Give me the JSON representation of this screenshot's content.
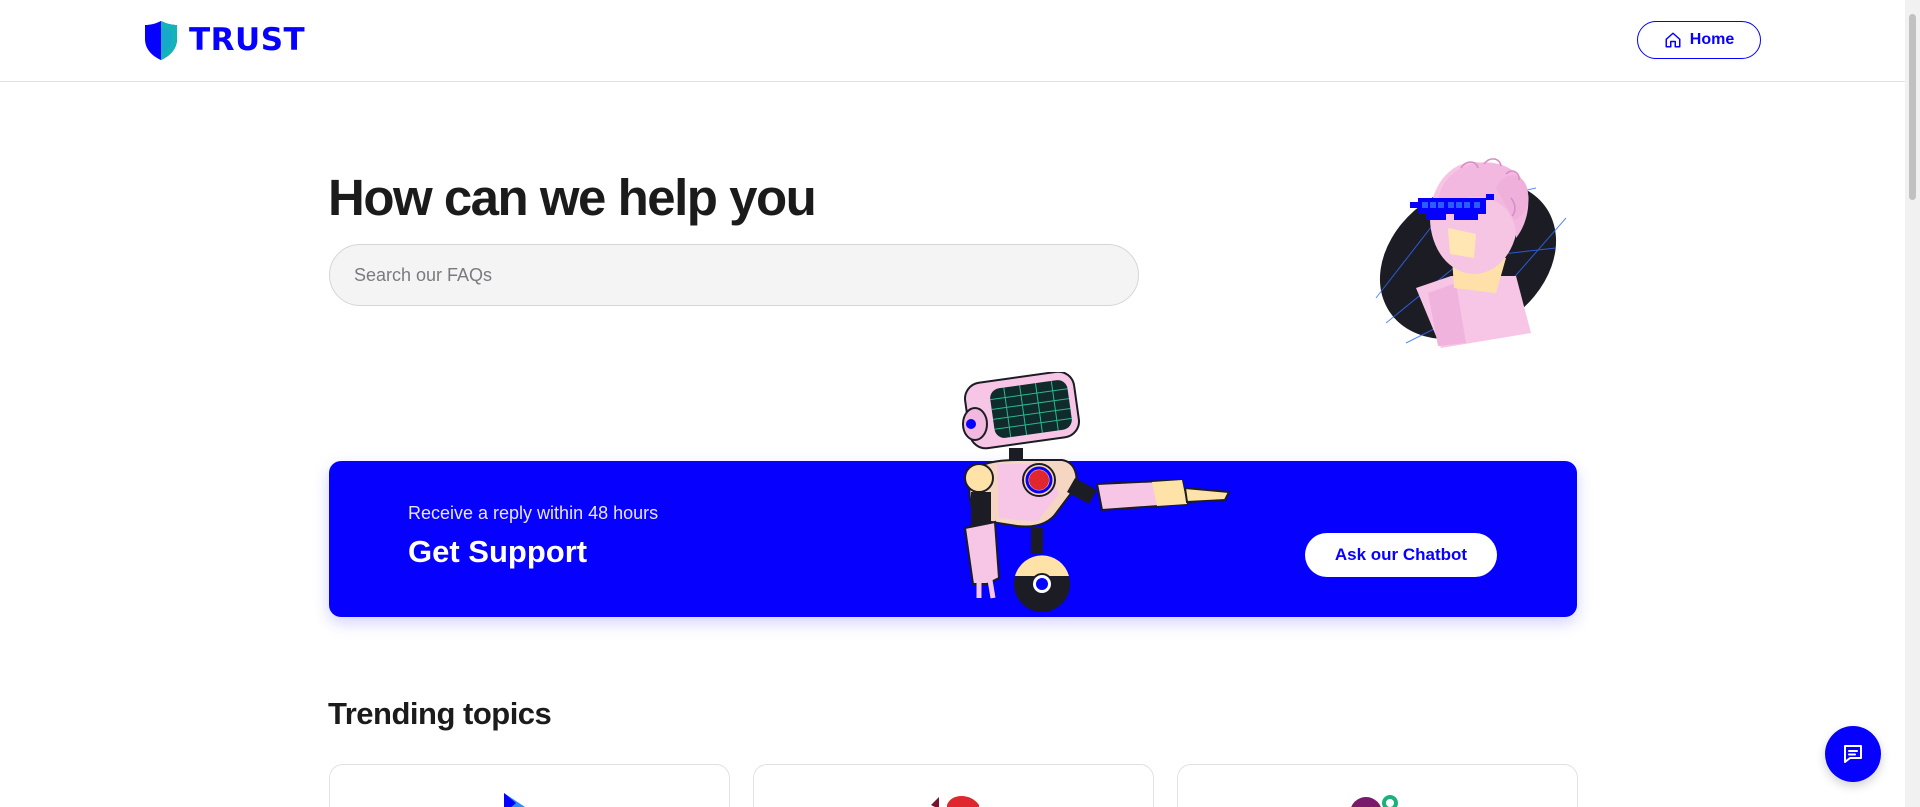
{
  "header": {
    "logo_text": "TRUST",
    "home_label": "Home"
  },
  "hero": {
    "title": "How can we help you",
    "search_placeholder": "Search our FAQs"
  },
  "support": {
    "subtitle": "Receive a reply within 48 hours",
    "title": "Get Support",
    "chatbot_label": "Ask our Chatbot"
  },
  "trending": {
    "title": "Trending topics",
    "cards": [
      {
        "icon": "topic-icon-blue"
      },
      {
        "icon": "topic-icon-red"
      },
      {
        "icon": "topic-icon-purple"
      }
    ]
  },
  "icons": {
    "home": "home-icon",
    "chat": "chat-icon",
    "logo": "shield-icon"
  },
  "colors": {
    "brand": "#0500ff",
    "text": "#1b1b1b",
    "search_bg": "#f4f4f5"
  }
}
